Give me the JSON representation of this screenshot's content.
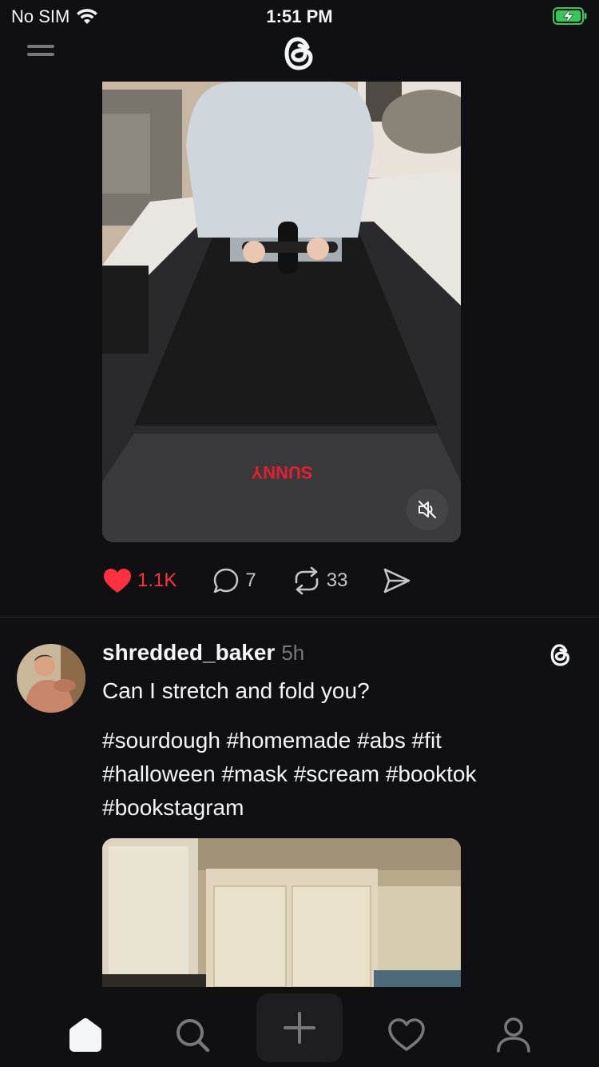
{
  "status_bar": {
    "carrier": "No SIM",
    "time": "1:51 PM",
    "wifi_icon": "wifi-icon",
    "battery_icon": "battery-charging-icon"
  },
  "header": {
    "menu_icon": "menu-icon",
    "logo_icon": "threads-logo-icon"
  },
  "post1": {
    "media": {
      "brand_text": "SUNNY",
      "mute_icon": "speaker-muted-icon"
    },
    "actions": {
      "likes": "1.1K",
      "replies": "7",
      "reposts": "33",
      "liked": true
    }
  },
  "post2": {
    "username": "shredded_baker",
    "time": "5h",
    "caption": "Can I stretch and fold you?",
    "hashtags_line1": "#sourdough #homemade #abs #fit",
    "hashtags_line2": "#halloween #mask #scream #booktok",
    "hashtags_line3": "#bookstagram"
  },
  "tabbar": {
    "items": [
      "home-icon",
      "search-icon",
      "plus-icon",
      "heart-icon",
      "profile-icon"
    ],
    "active": "home-icon"
  },
  "colors": {
    "background": "#101012",
    "like_red": "#ff3040",
    "secondary_text": "#77777c",
    "battery_green": "#34c759"
  }
}
